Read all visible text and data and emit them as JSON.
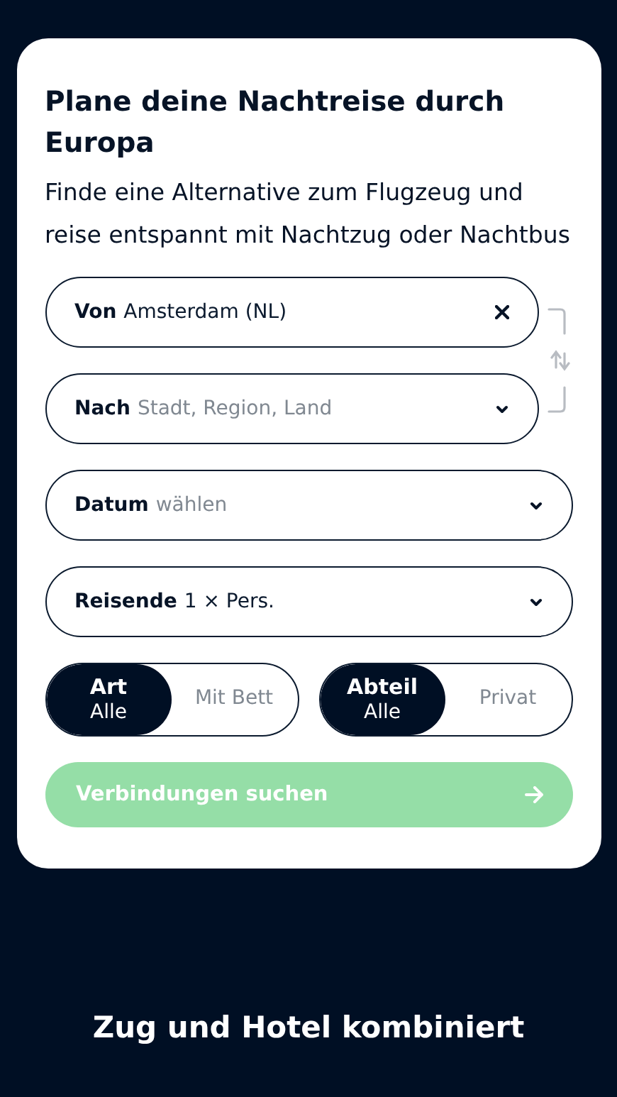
{
  "search_card": {
    "title": "Plane deine Nachtreise durch Europa",
    "description": "Finde eine Alternative zum Flugzeug und reise entspannt mit Nachtzug oder Nachtbus",
    "route_fields": [
      {
        "label": "Von",
        "value": "Amsterdam (NL)",
        "kind": "clear"
      },
      {
        "label": "Nach",
        "placeholder": "Stadt, Region, Land",
        "kind": "dropdown"
      }
    ],
    "fields": [
      {
        "label": "Datum",
        "placeholder": "wählen",
        "kind": "dropdown"
      },
      {
        "label": "Reisende",
        "value": "1 × Pers.",
        "kind": "dropdown"
      }
    ],
    "toggles": [
      {
        "label": "Art",
        "options": [
          {
            "label": "Alle",
            "selected": true
          },
          {
            "label": "Mit Bett",
            "selected": false
          }
        ]
      },
      {
        "label": "Abteil",
        "options": [
          {
            "label": "Alle",
            "selected": true
          },
          {
            "label": "Privat",
            "selected": false
          }
        ]
      }
    ],
    "search_button": {
      "label": "Verbindungen suchen",
      "disabled": true
    }
  },
  "next_section": {
    "heading": "Zug und Hotel kombiniert"
  }
}
